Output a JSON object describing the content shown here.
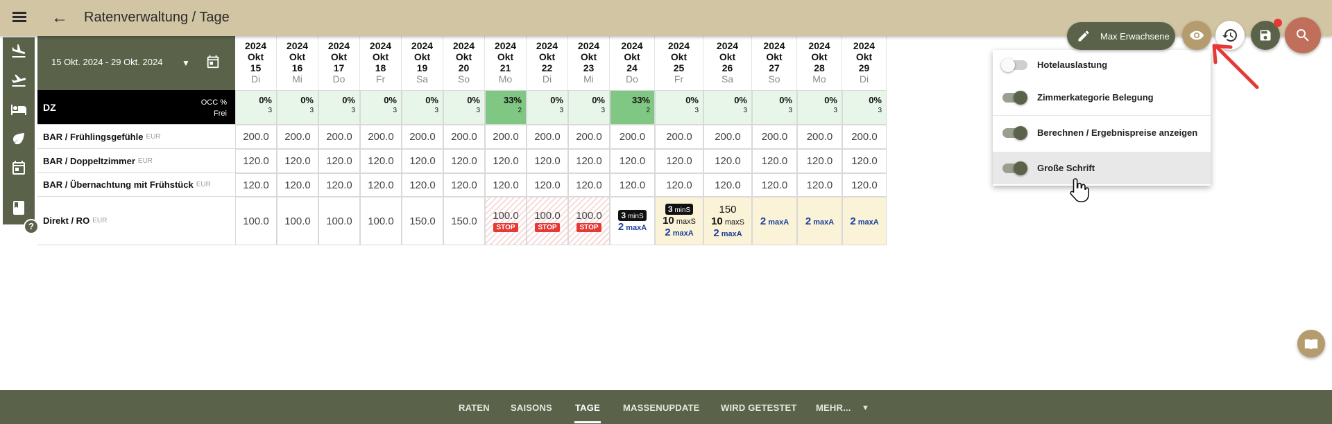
{
  "header": {
    "title": "Ratenverwaltung / Tage",
    "edit_label": "Max Erwachsene"
  },
  "date_range": "15 Okt. 2024 - 29 Okt. 2024",
  "days": [
    {
      "year": "2024",
      "month": "Okt",
      "day": "15",
      "wd": "Di"
    },
    {
      "year": "2024",
      "month": "Okt",
      "day": "16",
      "wd": "Mi"
    },
    {
      "year": "2024",
      "month": "Okt",
      "day": "17",
      "wd": "Do"
    },
    {
      "year": "2024",
      "month": "Okt",
      "day": "18",
      "wd": "Fr"
    },
    {
      "year": "2024",
      "month": "Okt",
      "day": "19",
      "wd": "Sa"
    },
    {
      "year": "2024",
      "month": "Okt",
      "day": "20",
      "wd": "So"
    },
    {
      "year": "2024",
      "month": "Okt",
      "day": "21",
      "wd": "Mo"
    },
    {
      "year": "2024",
      "month": "Okt",
      "day": "22",
      "wd": "Di"
    },
    {
      "year": "2024",
      "month": "Okt",
      "day": "23",
      "wd": "Mi"
    },
    {
      "year": "2024",
      "month": "Okt",
      "day": "24",
      "wd": "Do"
    },
    {
      "year": "2024",
      "month": "Okt",
      "day": "25",
      "wd": "Fr"
    },
    {
      "year": "2024",
      "month": "Okt",
      "day": "26",
      "wd": "Sa"
    },
    {
      "year": "2024",
      "month": "Okt",
      "day": "27",
      "wd": "So"
    },
    {
      "year": "2024",
      "month": "Okt",
      "day": "28",
      "wd": "Mo"
    },
    {
      "year": "2024",
      "month": "Okt",
      "day": "29",
      "wd": "Di"
    }
  ],
  "room": {
    "name": "DZ",
    "occ_label": "OCC %",
    "frei_label": "Frei",
    "occ": [
      "0%",
      "0%",
      "0%",
      "0%",
      "0%",
      "0%",
      "33%",
      "0%",
      "0%",
      "33%",
      "0%",
      "0%",
      "0%",
      "0%",
      "0%"
    ],
    "frei": [
      "3",
      "3",
      "3",
      "3",
      "3",
      "3",
      "2",
      "3",
      "3",
      "2",
      "3",
      "3",
      "3",
      "3",
      "3"
    ]
  },
  "rates": [
    {
      "name": "BAR / Frühlingsgefühle",
      "currency": "EUR",
      "values": [
        "200.0",
        "200.0",
        "200.0",
        "200.0",
        "200.0",
        "200.0",
        "200.0",
        "200.0",
        "200.0",
        "200.0",
        "200.0",
        "200.0",
        "200.0",
        "200.0",
        "200.0"
      ]
    },
    {
      "name": "BAR / Doppeltzimmer",
      "currency": "EUR",
      "values": [
        "120.0",
        "120.0",
        "120.0",
        "120.0",
        "120.0",
        "120.0",
        "120.0",
        "120.0",
        "120.0",
        "120.0",
        "120.0",
        "120.0",
        "120.0",
        "120.0",
        "120.0"
      ]
    },
    {
      "name": "BAR / Übernachtung mit Frühstück",
      "currency": "EUR",
      "values": [
        "120.0",
        "120.0",
        "120.0",
        "120.0",
        "120.0",
        "120.0",
        "120.0",
        "120.0",
        "120.0",
        "120.0",
        "120.0",
        "120.0",
        "120.0",
        "120.0",
        "120.0"
      ]
    }
  ],
  "direkt": {
    "name": "Direkt / RO",
    "currency": "EUR",
    "plain": [
      "100.0",
      "100.0",
      "100.0",
      "100.0",
      "150.0",
      "150.0"
    ],
    "stop_values": [
      "100.0",
      "100.0",
      "100.0"
    ],
    "stop_label": "STOP",
    "mins_label": "minS",
    "maxs_label": "maxS",
    "maxa_label": "maxA",
    "d24": {
      "mins": "3",
      "maxa": "2"
    },
    "d25": {
      "mins": "3",
      "maxs": "10",
      "maxa": "2"
    },
    "d26": {
      "price": "150",
      "maxs": "10",
      "maxa": "2"
    },
    "d27": {
      "maxa": "2"
    },
    "d28": {
      "maxa": "2"
    },
    "d29": {
      "maxa": "2"
    }
  },
  "dropdown": {
    "items": [
      {
        "label": "Hotelauslastung",
        "on": false
      },
      {
        "label": "Zimmerkategorie Belegung",
        "on": true
      },
      {
        "label": "Berechnen / Ergebnispreise anzeigen",
        "on": true
      },
      {
        "label": "Große Schrift",
        "on": true
      }
    ]
  },
  "bottom_nav": {
    "items": [
      "RATEN",
      "SAISONS",
      "TAGE",
      "MASSENUPDATE",
      "WIRD GETESTET",
      "MEHR..."
    ],
    "active": "TAGE"
  },
  "colors": {
    "header_bg": "#d2c5a3",
    "olive": "#5a6349",
    "occ_low": "#e8f5e9",
    "occ_high": "#81c784",
    "stop_red": "#e53935",
    "maxa_blue": "#1a3f9a",
    "yellow_cell": "#faf3d7"
  },
  "help_label": "?"
}
